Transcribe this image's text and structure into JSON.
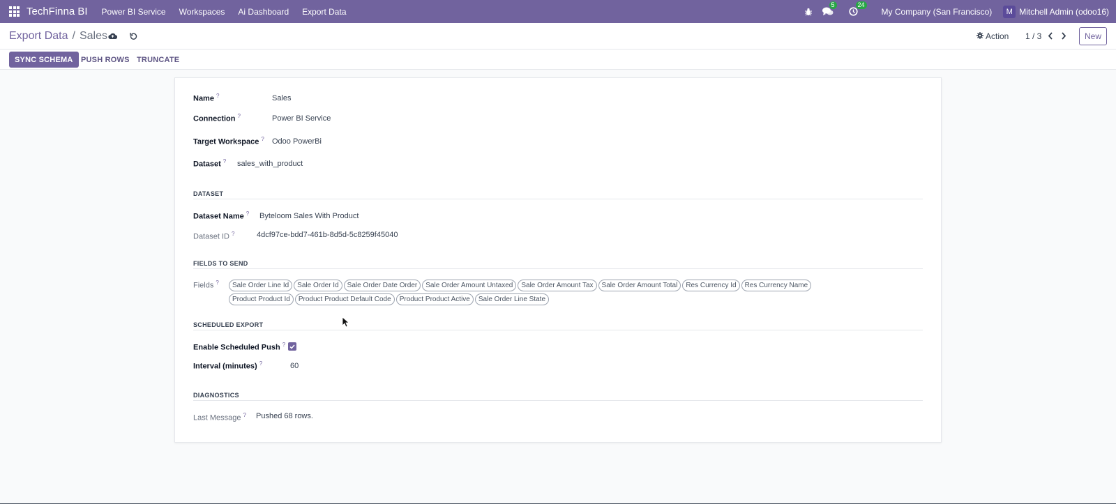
{
  "navbar": {
    "brand": "TechFinna BI",
    "menu": [
      "Power BI Service",
      "Workspaces",
      "Ai Dashboard",
      "Export Data"
    ],
    "messages_count": "5",
    "activities_count": "24",
    "company": "My Company (San Francisco)",
    "user_initial": "M",
    "user_name": "Mitchell Admin (odoo16)"
  },
  "control": {
    "breadcrumb_parent": "Export Data",
    "breadcrumb_sep": "/",
    "breadcrumb_current": "Sales",
    "action_label": "Action",
    "pager": "1 / 3",
    "new_label": "New"
  },
  "buttons": {
    "sync": "SYNC SCHEMA",
    "push": "PUSH ROWS",
    "truncate": "TRUNCATE"
  },
  "form": {
    "name_label": "Name",
    "name_value": "Sales",
    "connection_label": "Connection",
    "connection_value": "Power BI Service",
    "workspace_label": "Target Workspace",
    "workspace_value": "Odoo PowerBi",
    "dataset_label": "Dataset",
    "dataset_value": "sales_with_product",
    "section_dataset": "DATASET",
    "dataset_name_label": "Dataset Name",
    "dataset_name_value": "Byteloom Sales With Product",
    "dataset_id_label": "Dataset ID",
    "dataset_id_value": "4dcf97ce-bdd7-461b-8d5d-5c8259f45040",
    "section_fields": "FIELDS TO SEND",
    "fields_label": "Fields",
    "fields": [
      "Sale Order Line Id",
      "Sale Order Id",
      "Sale Order Date Order",
      "Sale Order Amount Untaxed",
      "Sale Order Amount Tax",
      "Sale Order Amount Total",
      "Res Currency Id",
      "Res Currency Name",
      "Product Product Id",
      "Product Product Default Code",
      "Product Product Active",
      "Sale Order Line State"
    ],
    "section_scheduled": "SCHEDULED EXPORT",
    "enable_label": "Enable Scheduled Push",
    "enable_checked": true,
    "interval_label": "Interval (minutes)",
    "interval_value": "60",
    "section_diag": "DIAGNOSTICS",
    "last_message_label": "Last Message",
    "last_message_value": "Pushed 68 rows."
  },
  "help_marker": "?",
  "colors": {
    "brand": "#71639e",
    "badge": "#28a745"
  }
}
